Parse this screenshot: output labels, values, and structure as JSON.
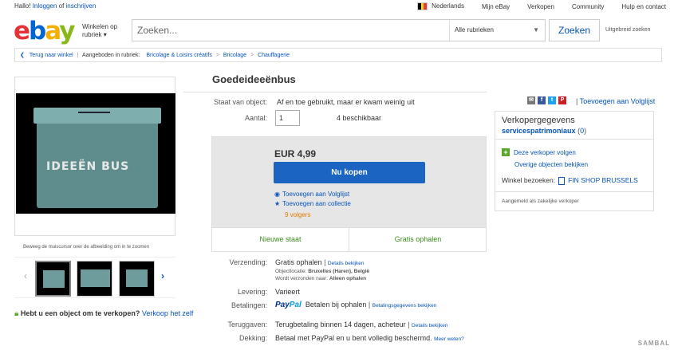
{
  "topbar": {
    "greeting": "Hallo!",
    "login_link": "Inloggen",
    "or": "of",
    "register_link": "inschrijven",
    "country": "Nederlands",
    "my_ebay": "Mijn eBay",
    "selling": "Verkopen",
    "community": "Community",
    "help": "Hulp en contact"
  },
  "header": {
    "logo": {
      "e": "e",
      "b": "b",
      "a": "a",
      "y": "y"
    },
    "shop_by_line1": "Winkelen op",
    "shop_by_line2": "rubriek",
    "search_placeholder": "Zoeken...",
    "category": "Alle rubrieken",
    "search_button": "Zoeken",
    "advanced": "Uitgebreid zoeken"
  },
  "breadcrumb": {
    "back": "Terug naar winkel",
    "listed_in": "Aangeboden in rubriek:",
    "items": [
      "Bricolage & Loisirs créatifs",
      "Bricolage",
      "Chauffagerie"
    ]
  },
  "images": {
    "box_text": "IDEEËN BUS",
    "zoom_hint": "Beweeg de muiscursor over de afbeelding om in te zoomen"
  },
  "sell_promo": {
    "text": "Hebt u een object om te verkopen?",
    "link": "Verkoop het zelf"
  },
  "item": {
    "title": "Goedeideeënbus",
    "condition_label": "Staat van object:",
    "condition_value": "Af en toe gebruikt, maar er kwam weinig uit",
    "qty_label": "Aantal:",
    "qty_value": "1",
    "available": "4 beschikbaar",
    "price": "EUR 4,99",
    "buy_button": "Nu kopen",
    "add_watchlist": "Toevoegen aan Volglijst",
    "add_collection": "Toevoegen aan collectie",
    "followers": "9 volgers",
    "cond_new": "Nieuwe staat",
    "pickup_free": "Gratis ophalen"
  },
  "details": {
    "shipping_label": "Verzending:",
    "shipping_value": "Gratis ophalen",
    "details_link": "Details bekijken",
    "location_label": "Objectlocatie:",
    "location_value": "Bruxelles (Haren), België",
    "ships_to_label": "Wordt verzonden naar:",
    "ships_to_value": "Alleen ophalen",
    "delivery_label": "Levering:",
    "delivery_value": "Varieert",
    "payment_label": "Betalingen:",
    "paypal_a": "Pay",
    "paypal_b": "Pal",
    "payment_value": "Betalen bij ophalen",
    "payment_details": "Betalingsgegevens bekijken",
    "returns_label": "Teruggaven:",
    "returns_value": "Terugbetaling binnen 14 dagen, acheteur",
    "returns_details": "Details bekijken",
    "coverage_label": "Dekking:",
    "coverage_value": "Betaal met PayPal en u bent volledig beschermd.",
    "more_info": "Meer weten?"
  },
  "seller": {
    "add_watchlist": "Toevoegen aan Volglijst",
    "heading": "Verkopergegevens",
    "name": "servicespatrimoniaux",
    "rating": "0",
    "follow": "Deze verkoper volgen",
    "other_items": "Overige objecten bekijken",
    "store_label": "Winkel bezoeken:",
    "store_name": "FIN SHOP BRUSSELS",
    "registered": "Aangemeld als zakelijke verkoper"
  },
  "watermark": "SAMBAL",
  "colors": {
    "link": "#0654ba",
    "buy_button": "#1b64c2",
    "green": "#3a8c1a",
    "followers": "#e07b00"
  }
}
